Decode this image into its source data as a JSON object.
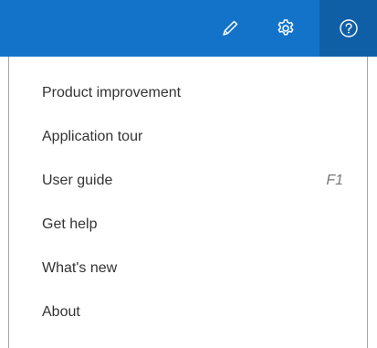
{
  "toolbar": {
    "buttons": [
      {
        "icon": "pencil-icon"
      },
      {
        "icon": "gear-icon"
      },
      {
        "icon": "help-icon"
      }
    ],
    "colors": {
      "background": "#1373c9",
      "active": "#0f5fa6"
    }
  },
  "help_menu": {
    "items": [
      {
        "label": "Product improvement",
        "shortcut": ""
      },
      {
        "label": "Application tour",
        "shortcut": ""
      },
      {
        "label": "User guide",
        "shortcut": "F1"
      },
      {
        "label": "Get help",
        "shortcut": ""
      },
      {
        "label": "What's new",
        "shortcut": ""
      },
      {
        "label": "About",
        "shortcut": ""
      }
    ]
  }
}
